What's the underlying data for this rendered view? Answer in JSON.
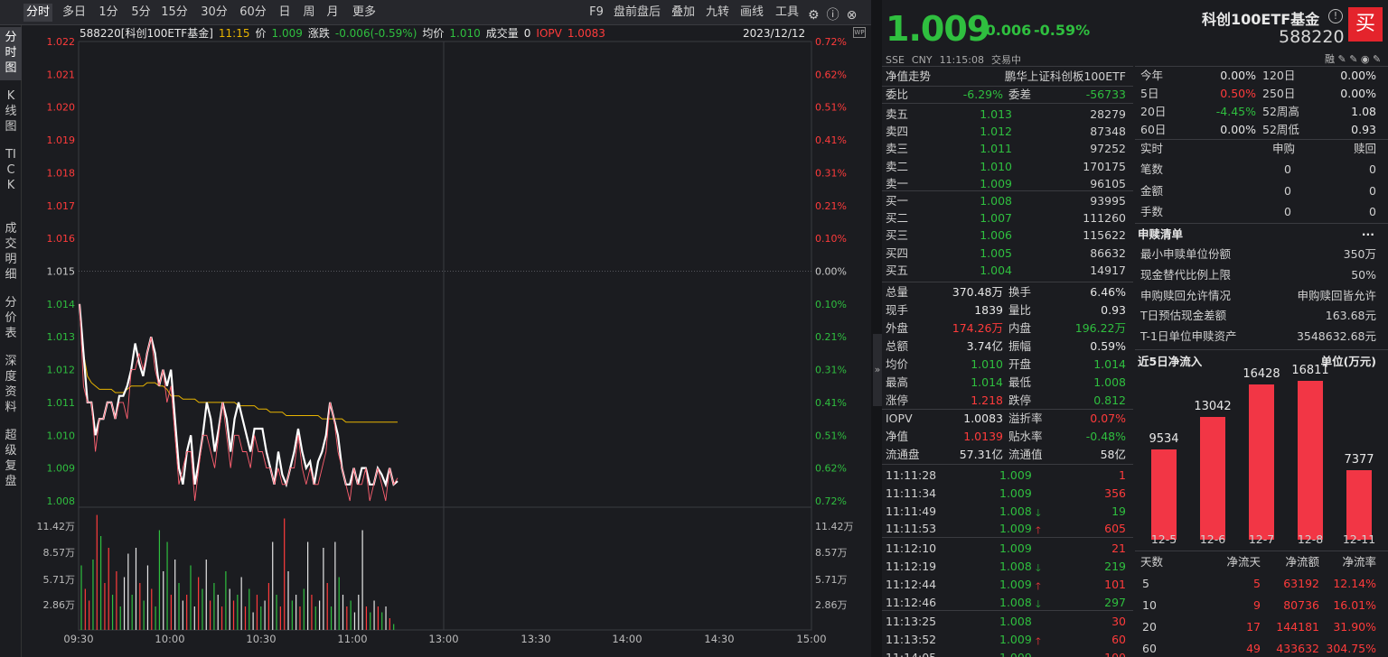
{
  "toolbar": {
    "tabs": [
      "分时",
      "多日",
      "1分",
      "5分",
      "15分",
      "30分",
      "60分",
      "日",
      "周",
      "月",
      "更多"
    ],
    "right": [
      "F9",
      "盘前盘后",
      "叠加",
      "九转",
      "画线",
      "工具"
    ]
  },
  "left_tabs": [
    "分时图",
    "K线图",
    "TICK",
    "成交明细",
    "分价表",
    "深度资料",
    "超级复盘"
  ],
  "info": {
    "code_name": "588220[科创100ETF基金]",
    "time": "11:15",
    "price_label": "价",
    "price": "1.009",
    "change_label": "涨跌",
    "change": "-0.006(-0.59%)",
    "avg_label": "均价",
    "avg": "1.010",
    "vol_label": "成交量",
    "vol": "0",
    "iopv_label": "IOPV",
    "iopv": "1.0083",
    "date": "2023/12/12"
  },
  "chart_data": {
    "type": "line",
    "y_left_ticks": [
      "1.022",
      "1.021",
      "1.020",
      "1.019",
      "1.018",
      "1.017",
      "1.016",
      "1.015",
      "1.014",
      "1.013",
      "1.012",
      "1.011",
      "1.010",
      "1.009",
      "1.008"
    ],
    "y_right_ticks": [
      "0.72%",
      "0.62%",
      "0.51%",
      "0.41%",
      "0.31%",
      "0.21%",
      "0.10%",
      "0.00%",
      "0.10%",
      "0.21%",
      "0.31%",
      "0.41%",
      "0.51%",
      "0.62%",
      "0.72%"
    ],
    "ylim": [
      1.008,
      1.022
    ],
    "prev_close": 1.015,
    "x_ticks": [
      "09:30",
      "10:00",
      "10:30",
      "11:00",
      "13:00",
      "13:30",
      "14:00",
      "14:30",
      "15:00"
    ],
    "vol_ticks": [
      "11.42万",
      "8.57万",
      "5.71万",
      "2.86万"
    ],
    "series": [
      {
        "values": [
          1.014,
          1.0125,
          1.011,
          1.011,
          1.01,
          1.0105,
          1.0105,
          1.011,
          1.011,
          1.0105,
          1.0112,
          1.0112,
          1.0115,
          1.012,
          1.0128,
          1.0122,
          1.0118,
          1.0125,
          1.013,
          1.0125,
          1.0115,
          1.012,
          1.0115,
          1.012,
          1.0105,
          1.009,
          1.0085,
          1.0095,
          1.01,
          1.0085,
          1.0092,
          1.01,
          1.011,
          1.0105,
          1.0095,
          1.0102,
          1.011,
          1.0105,
          1.0095,
          1.0105,
          1.011,
          1.0105,
          1.01,
          1.0095,
          1.0102,
          1.0102,
          1.0102,
          1.0095,
          1.009,
          1.0085,
          1.0095,
          1.0088,
          1.0085,
          1.009,
          1.0095,
          1.0102,
          1.0095,
          1.009,
          1.0092,
          1.0085,
          1.0092,
          1.0095,
          1.01,
          1.011,
          1.0105,
          1.01,
          1.009,
          1.0085,
          1.0085,
          1.009,
          1.0085,
          1.009,
          1.009,
          1.0085,
          1.0085,
          1.009,
          1.0088,
          1.0085,
          1.009,
          1.0085,
          1.0086
        ]
      },
      {
        "values": [
          1.014,
          1.0125,
          1.0118,
          1.0116,
          1.0115,
          1.0114,
          1.0114,
          1.0114,
          1.0114,
          1.0113,
          1.0113,
          1.0113,
          1.0114,
          1.0115,
          1.0115,
          1.0115,
          1.0115,
          1.0116,
          1.0116,
          1.0116,
          1.0115,
          1.0115,
          1.0114,
          1.0112,
          1.0112,
          1.0112,
          1.0111,
          1.0111,
          1.0111,
          1.0111,
          1.011,
          1.011,
          1.011,
          1.011,
          1.011,
          1.011,
          1.011,
          1.011,
          1.011,
          1.011,
          1.0109,
          1.0109,
          1.0109,
          1.0109,
          1.0109,
          1.0108,
          1.0108,
          1.0108,
          1.0107,
          1.0107,
          1.0107,
          1.0107,
          1.0106,
          1.0106,
          1.0106,
          1.0106,
          1.0106,
          1.0106,
          1.0106,
          1.0106,
          1.0106,
          1.0105,
          1.0105,
          1.0105,
          1.0105,
          1.0105,
          1.0105,
          1.0104,
          1.0104,
          1.0104,
          1.0104,
          1.0104,
          1.0104,
          1.0104,
          1.0104,
          1.0104,
          1.0104,
          1.0104,
          1.0104,
          1.0104,
          1.0104
        ]
      },
      {
        "values": [
          1.014,
          1.0115,
          1.011,
          1.011,
          1.0095,
          1.0105,
          1.0105,
          1.011,
          1.011,
          1.0105,
          1.011,
          1.011,
          1.0105,
          1.012,
          1.012,
          1.0125,
          1.012,
          1.0125,
          1.013,
          1.012,
          1.0115,
          1.012,
          1.011,
          1.0115,
          1.01,
          1.0085,
          1.009,
          1.0095,
          1.0095,
          1.008,
          1.009,
          1.01,
          1.01,
          1.0095,
          1.009,
          1.01,
          1.011,
          1.01,
          1.009,
          1.01,
          1.01,
          1.0095,
          1.0095,
          1.009,
          1.01,
          1.0095,
          1.0095,
          1.009,
          1.009,
          1.0085,
          1.009,
          1.0085,
          1.0085,
          1.009,
          1.009,
          1.01,
          1.009,
          1.0085,
          1.009,
          1.0085,
          1.0085,
          1.009,
          1.0095,
          1.011,
          1.0105,
          1.0095,
          1.009,
          1.0085,
          1.008,
          1.009,
          1.0085,
          1.0085,
          1.009,
          1.008,
          1.0085,
          1.009,
          1.0085,
          1.008,
          1.009,
          1.0085,
          1.0087
        ]
      }
    ],
    "volumes": [
      [
        0.55,
        "g"
      ],
      [
        0.35,
        "r"
      ],
      [
        0.25,
        "r"
      ],
      [
        0.6,
        "g"
      ],
      [
        0.98,
        "r"
      ],
      [
        0.8,
        "g"
      ],
      [
        0.4,
        "r"
      ],
      [
        0.7,
        "r"
      ],
      [
        0.3,
        "g"
      ],
      [
        0.5,
        "r"
      ],
      [
        0.2,
        "g"
      ],
      [
        0.45,
        "w"
      ],
      [
        0.65,
        "w"
      ],
      [
        0.3,
        "g"
      ],
      [
        0.7,
        "w"
      ],
      [
        0.4,
        "r"
      ],
      [
        0.25,
        "g"
      ],
      [
        0.55,
        "w"
      ],
      [
        0.35,
        "r"
      ],
      [
        0.2,
        "g"
      ],
      [
        0.85,
        "g"
      ],
      [
        0.5,
        "w"
      ],
      [
        0.75,
        "g"
      ],
      [
        0.3,
        "r"
      ],
      [
        0.6,
        "w"
      ],
      [
        0.4,
        "g"
      ],
      [
        0.25,
        "w"
      ],
      [
        0.3,
        "r"
      ],
      [
        0.55,
        "g"
      ],
      [
        0.2,
        "w"
      ],
      [
        0.45,
        "r"
      ],
      [
        0.35,
        "g"
      ],
      [
        0.6,
        "w"
      ],
      [
        0.25,
        "r"
      ],
      [
        0.4,
        "g"
      ],
      [
        0.3,
        "w"
      ],
      [
        0.2,
        "r"
      ],
      [
        0.5,
        "g"
      ],
      [
        0.35,
        "w"
      ],
      [
        0.25,
        "r"
      ],
      [
        0.3,
        "g"
      ],
      [
        0.45,
        "w"
      ],
      [
        0.2,
        "r"
      ],
      [
        0.35,
        "g"
      ],
      [
        0.15,
        "w"
      ],
      [
        0.3,
        "r"
      ],
      [
        0.2,
        "g"
      ],
      [
        0.25,
        "w"
      ],
      [
        0.4,
        "r"
      ],
      [
        0.75,
        "w"
      ],
      [
        0.3,
        "g"
      ],
      [
        0.2,
        "r"
      ],
      [
        0.95,
        "r"
      ],
      [
        0.5,
        "w"
      ],
      [
        0.25,
        "g"
      ],
      [
        0.3,
        "w"
      ],
      [
        0.2,
        "r"
      ],
      [
        0.35,
        "g"
      ],
      [
        0.75,
        "w"
      ],
      [
        0.3,
        "r"
      ],
      [
        0.2,
        "g"
      ],
      [
        0.25,
        "w"
      ],
      [
        0.7,
        "w"
      ],
      [
        0.4,
        "r"
      ],
      [
        0.2,
        "g"
      ],
      [
        0.75,
        "w"
      ],
      [
        0.45,
        "g"
      ],
      [
        0.3,
        "w"
      ],
      [
        0.2,
        "r"
      ],
      [
        0.25,
        "g"
      ],
      [
        0.15,
        "w"
      ],
      [
        0.3,
        "w"
      ],
      [
        0.85,
        "w"
      ],
      [
        0.2,
        "r"
      ],
      [
        0.15,
        "g"
      ],
      [
        0.25,
        "w"
      ],
      [
        0.2,
        "r"
      ],
      [
        0.15,
        "g"
      ],
      [
        0.2,
        "w"
      ],
      [
        0.1,
        "r"
      ],
      [
        0.05,
        "g"
      ]
    ]
  },
  "quote": {
    "price": "1.009",
    "change": "-0.006",
    "change_pct": "-0.59%",
    "meta": [
      "SSE",
      "CNY",
      "11:15:08",
      "交易中"
    ],
    "nav_trend_label": "净值走势",
    "nav_name": "鹏华上证科创板100ETF",
    "weibi_label": "委比",
    "weibi": "-6.29%",
    "weicha_label": "委差",
    "weicha": "-56733",
    "asks": [
      [
        "卖五",
        "1.013",
        "28279"
      ],
      [
        "卖四",
        "1.012",
        "87348"
      ],
      [
        "卖三",
        "1.011",
        "97252"
      ],
      [
        "卖二",
        "1.010",
        "170175"
      ],
      [
        "卖一",
        "1.009",
        "96105"
      ]
    ],
    "bids": [
      [
        "买一",
        "1.008",
        "93995"
      ],
      [
        "买二",
        "1.007",
        "111260"
      ],
      [
        "买三",
        "1.006",
        "115622"
      ],
      [
        "买四",
        "1.005",
        "86632"
      ],
      [
        "买五",
        "1.004",
        "14917"
      ]
    ],
    "stats": [
      [
        "总量",
        "370.48万",
        "换手",
        "6.46%"
      ],
      [
        "现手",
        "1839",
        "量比",
        "0.93"
      ],
      [
        "外盘",
        "174.26万",
        "内盘",
        "196.22万"
      ],
      [
        "总额",
        "3.74亿",
        "振幅",
        "0.59%"
      ],
      [
        "均价",
        "1.010",
        "开盘",
        "1.014"
      ],
      [
        "最高",
        "1.014",
        "最低",
        "1.008"
      ],
      [
        "涨停",
        "1.218",
        "跌停",
        "0.812"
      ]
    ],
    "stats2": [
      [
        "IOPV",
        "1.0083",
        "溢折率",
        "0.07%"
      ],
      [
        "净值",
        "1.0139",
        "贴水率",
        "-0.48%"
      ],
      [
        "流通盘",
        "57.31亿",
        "流通值",
        "58亿"
      ]
    ],
    "ticks": [
      [
        "11:11:28",
        "1.009",
        "",
        "1"
      ],
      [
        "11:11:34",
        "1.009",
        "",
        "356"
      ],
      [
        "11:11:49",
        "1.008",
        "down",
        "19"
      ],
      [
        "11:11:53",
        "1.009",
        "up",
        "605"
      ],
      [
        "11:12:10",
        "1.009",
        "",
        "21"
      ],
      [
        "11:12:19",
        "1.008",
        "down",
        "219"
      ],
      [
        "11:12:44",
        "1.009",
        "up",
        "101"
      ],
      [
        "11:12:46",
        "1.008",
        "down",
        "297"
      ],
      [
        "11:13:25",
        "1.008",
        "",
        "30"
      ],
      [
        "11:13:52",
        "1.009",
        "up",
        "60"
      ],
      [
        "11:14:05",
        "1.009",
        "",
        "100"
      ]
    ]
  },
  "fund": {
    "name": "科创100ETF基金",
    "code": "588220",
    "buy_label": "买",
    "icons_text": "融 ✎ ✎ ◉ ✎",
    "perf": [
      [
        "今年",
        "0.00%",
        "120日",
        "0.00%"
      ],
      [
        "5日",
        "0.50%",
        "250日",
        "0.00%"
      ],
      [
        "20日",
        "-4.45%",
        "52周高",
        "1.08"
      ],
      [
        "60日",
        "0.00%",
        "52周低",
        "0.93"
      ]
    ],
    "realtime_header": [
      "实时",
      "申购",
      "赎回"
    ],
    "realtime": [
      [
        "笔数",
        "0",
        "0"
      ],
      [
        "金额",
        "0",
        "0"
      ],
      [
        "手数",
        "0",
        "0"
      ]
    ],
    "redeem_title": "申赎清单",
    "redeem_more": "···",
    "redeem": [
      [
        "最小申赎单位份额",
        "350万"
      ],
      [
        "现金替代比例上限",
        "50%"
      ],
      [
        "申购赎回允许情况",
        "申购赎回皆允许"
      ],
      [
        "T日预估现金差额",
        "163.68元"
      ],
      [
        "T-1日单位申赎资产",
        "3548632.68元"
      ]
    ],
    "inflow_title": "近5日净流入",
    "inflow_unit": "单位(万元)",
    "inflow_chart": {
      "type": "bar",
      "categories": [
        "12-5",
        "12-6",
        "12-7",
        "12-8",
        "12-11"
      ],
      "values": [
        9534,
        13042,
        16428,
        16811,
        7377
      ]
    },
    "flow_header": [
      "天数",
      "净流天",
      "净流额",
      "净流率"
    ],
    "flow": [
      [
        "5",
        "5",
        "63192",
        "12.14%"
      ],
      [
        "10",
        "9",
        "80736",
        "16.01%"
      ],
      [
        "20",
        "17",
        "144181",
        "31.90%"
      ],
      [
        "60",
        "49",
        "433632",
        "304.75%"
      ]
    ]
  }
}
